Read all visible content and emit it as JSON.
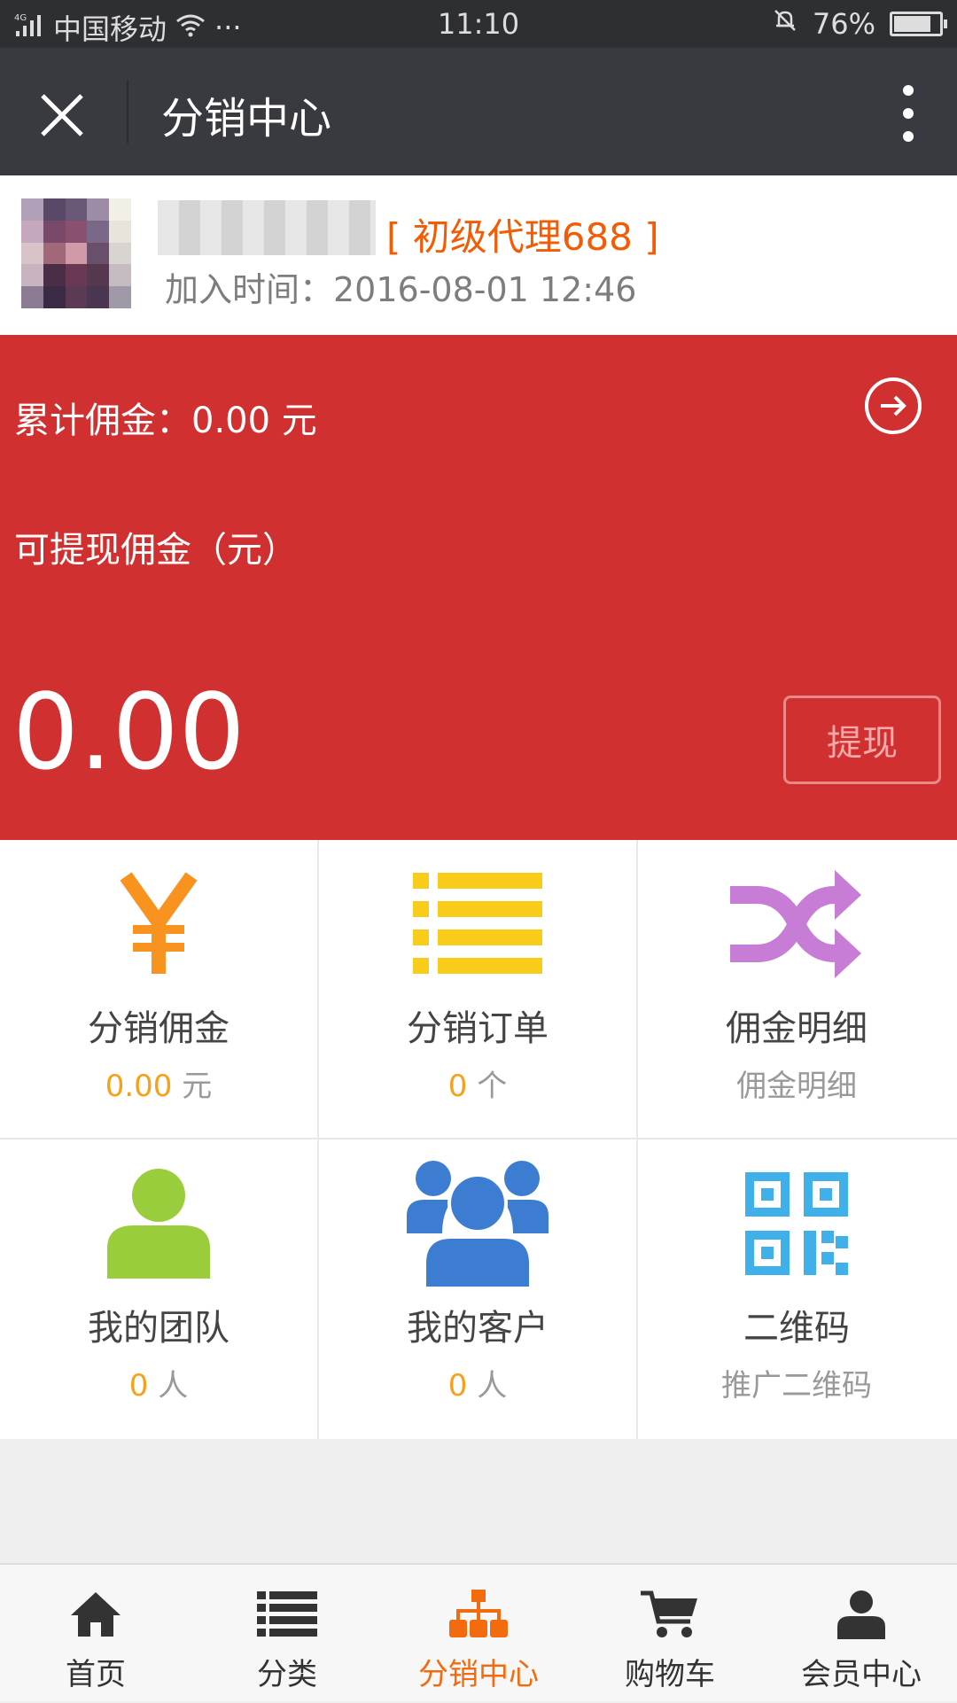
{
  "status_bar": {
    "carrier": "中国移动",
    "network": "4G",
    "time": "11:10",
    "battery": "76%",
    "battery_level": 0.76
  },
  "title_bar": {
    "title": "分销中心",
    "close_icon": "close-icon",
    "more_icon": "more-vertical-icon"
  },
  "profile": {
    "level": "[ 初级代理688 ]",
    "join_time": "加入时间：2016-08-01 12:46"
  },
  "commission_panel": {
    "cumulative": "累计佣金：0.00 元",
    "withdrawable_label": "可提现佣金（元）",
    "amount": "0.00",
    "withdraw_button": "提现",
    "background_color": "#d03030"
  },
  "grid": [
    {
      "title": "分销佣金",
      "value": "0.00",
      "unit": " 元",
      "icon": "yen-icon",
      "color": "#f7931e"
    },
    {
      "title": "分销订单",
      "value": "0",
      "unit": " 个",
      "icon": "list-icon",
      "color": "#f9cc1c"
    },
    {
      "title": "佣金明细",
      "value": "",
      "unit": "佣金明细",
      "icon": "shuffle-icon",
      "color": "#c77dd6"
    },
    {
      "title": "我的团队",
      "value": "0",
      "unit": " 人",
      "icon": "user-icon",
      "color": "#9acd3c"
    },
    {
      "title": "我的客户",
      "value": "0",
      "unit": " 人",
      "icon": "users-icon",
      "color": "#3d7dd1"
    },
    {
      "title": "二维码",
      "value": "",
      "unit": "推广二维码",
      "icon": "qrcode-icon",
      "color": "#3fb0ea"
    }
  ],
  "bottom_nav": [
    {
      "label": "首页",
      "icon": "home-icon",
      "active": false
    },
    {
      "label": "分类",
      "icon": "list-icon",
      "active": false
    },
    {
      "label": "分销中心",
      "icon": "sitemap-icon",
      "active": true
    },
    {
      "label": "购物车",
      "icon": "cart-icon",
      "active": false
    },
    {
      "label": "会员中心",
      "icon": "user-icon",
      "active": false
    }
  ],
  "accent_color": "#f26b0f"
}
